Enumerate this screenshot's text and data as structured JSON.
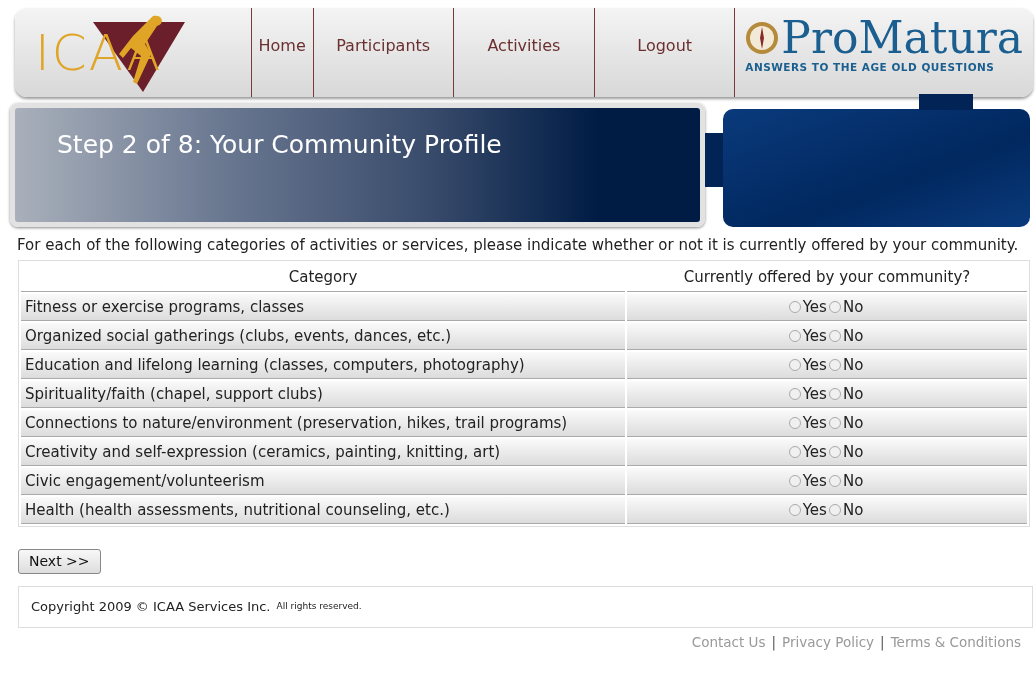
{
  "header": {
    "logo_left": "ICAA",
    "nav": [
      {
        "label": "Home"
      },
      {
        "label": "Participants"
      },
      {
        "label": "Activities"
      },
      {
        "label": "Logout"
      }
    ],
    "logo_right": {
      "name": "ProMatura",
      "tagline": "ANSWERS TO THE AGE OLD QUESTIONS"
    }
  },
  "banner": {
    "title": "Step 2 of 8: Your Community Profile"
  },
  "intro": "For each of the following categories of activities or services, please indicate whether or not it is currently offered by your community.",
  "table": {
    "columns": [
      "Category",
      "Currently offered by your community?"
    ],
    "rows": [
      {
        "category": "Fitness or exercise programs, classes",
        "options": [
          {
            "label": "Yes",
            "selected": false
          },
          {
            "label": "No",
            "selected": false
          }
        ]
      },
      {
        "category": "Organized social gatherings (clubs, events, dances, etc.)",
        "options": [
          {
            "label": "Yes",
            "selected": false
          },
          {
            "label": "No",
            "selected": false
          }
        ]
      },
      {
        "category": "Education and lifelong learning (classes, computers, photography)",
        "options": [
          {
            "label": "Yes",
            "selected": false
          },
          {
            "label": "No",
            "selected": false
          }
        ]
      },
      {
        "category": "Spirituality/faith (chapel, support clubs)",
        "options": [
          {
            "label": "Yes",
            "selected": false
          },
          {
            "label": "No",
            "selected": false
          }
        ]
      },
      {
        "category": "Connections to nature/environment (preservation, hikes, trail programs)",
        "options": [
          {
            "label": "Yes",
            "selected": false
          },
          {
            "label": "No",
            "selected": false
          }
        ]
      },
      {
        "category": "Creativity and self-expression (ceramics, painting, knitting, art)",
        "options": [
          {
            "label": "Yes",
            "selected": false
          },
          {
            "label": "No",
            "selected": false
          }
        ]
      },
      {
        "category": "Civic engagement/volunteerism",
        "options": [
          {
            "label": "Yes",
            "selected": false
          },
          {
            "label": "No",
            "selected": false
          }
        ]
      },
      {
        "category": "Health (health assessments, nutritional counseling, etc.)",
        "options": [
          {
            "label": "Yes",
            "selected": false
          },
          {
            "label": "No",
            "selected": false
          }
        ]
      }
    ]
  },
  "next_button": "Next >>",
  "footer": {
    "copyright": "Copyright 2009 © ICAA Services Inc.",
    "rights": "All rights reserved.",
    "links": [
      "Contact Us",
      "Privacy Policy",
      "Terms & Conditions"
    ],
    "link_separator": "|"
  }
}
